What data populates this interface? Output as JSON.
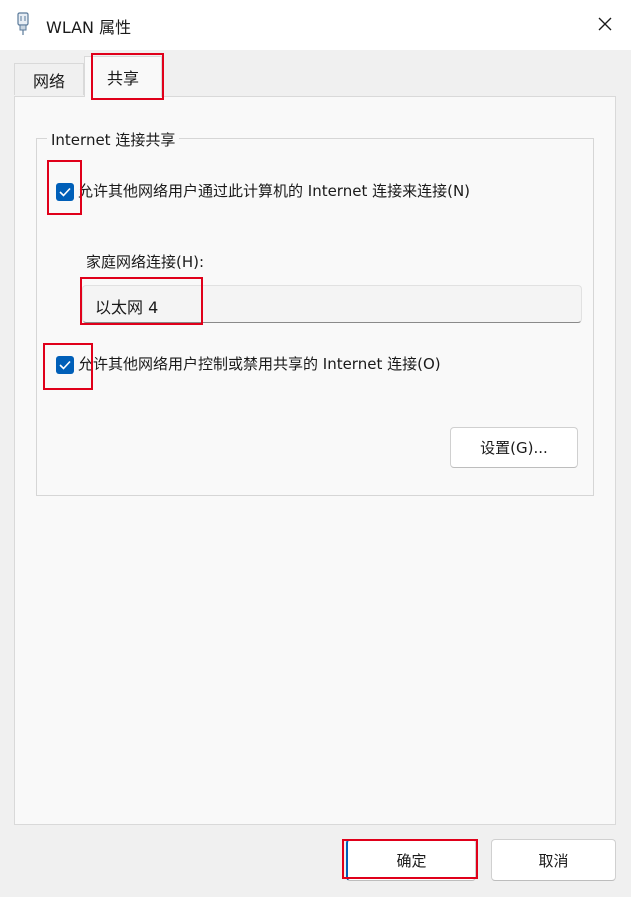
{
  "window": {
    "title": "WLAN 属性",
    "app_icon": "network-adapter-icon",
    "close_icon": "close-icon"
  },
  "tabs": [
    {
      "label": "网络",
      "selected": false
    },
    {
      "label": "共享",
      "selected": true
    }
  ],
  "group": {
    "legend": "Internet 连接共享",
    "allow_sharing": {
      "label": "允许其他网络用户通过此计算机的 Internet 连接来连接(N)",
      "checked": true
    },
    "home_network": {
      "label": "家庭网络连接(H):",
      "value": "以太网 4"
    },
    "allow_control": {
      "label": "允许其他网络用户控制或禁用共享的 Internet 连接(O)",
      "checked": true
    },
    "settings_button": "设置(G)..."
  },
  "footer": {
    "ok_button": "确定",
    "cancel_button": "取消"
  },
  "colors": {
    "accent": "#005fb8",
    "highlight": "#e0001a"
  }
}
